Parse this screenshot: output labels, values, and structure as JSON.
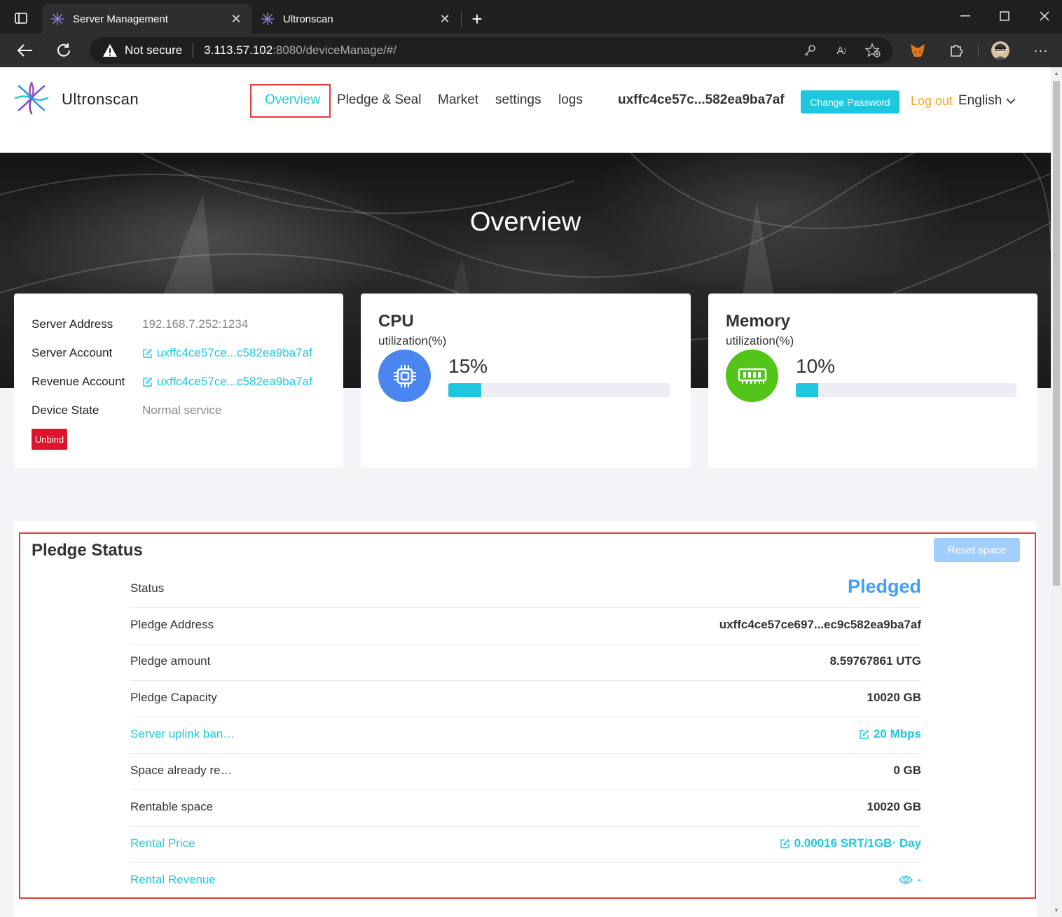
{
  "browser": {
    "tabs": [
      {
        "title": "Server Management",
        "active": true
      },
      {
        "title": "Ultronscan",
        "active": false
      }
    ],
    "address": {
      "security": "Not secure",
      "host": "3.113.57.102",
      "rest": ":8080/deviceManage/#/"
    }
  },
  "header": {
    "brand": "Ultronscan",
    "menu": [
      {
        "label": "Overview",
        "active": true
      },
      {
        "label": "Pledge & Seal"
      },
      {
        "label": "Market"
      },
      {
        "label": "settings"
      },
      {
        "label": "logs"
      }
    ],
    "account": "uxffc4ce57c...582ea9ba7af",
    "change_password": "Change Password",
    "logout": "Log out",
    "language": "English"
  },
  "hero": {
    "title": "Overview"
  },
  "server_card": {
    "rows": [
      {
        "label": "Server Address",
        "value": "192.168.7.252:1234"
      },
      {
        "label": "Server Account",
        "value": "uxffc4ce57ce...c582ea9ba7af"
      },
      {
        "label": "Revenue Account",
        "value": "uxffc4ce57ce...c582ea9ba7af"
      },
      {
        "label": "Device State",
        "value": "Normal service"
      }
    ],
    "unbind": "Unbind"
  },
  "cpu": {
    "title": "CPU",
    "subtitle": "utilization(%)",
    "percent_text": "15%",
    "percent": 15
  },
  "memory": {
    "title": "Memory",
    "subtitle": "utilization(%)",
    "percent_text": "10%",
    "percent": 10
  },
  "pledge": {
    "title": "Pledge Status",
    "reset": "Reset space",
    "rows": [
      {
        "label": "Status",
        "value": "Pledged"
      },
      {
        "label": "Pledge Address",
        "value": "uxffc4ce57ce697...ec9c582ea9ba7af"
      },
      {
        "label": "Pledge amount",
        "value": "8.59767861 UTG"
      },
      {
        "label": "Pledge Capacity",
        "value": "10020 GB"
      },
      {
        "label": "Server uplink ban…",
        "value": "20 Mbps"
      },
      {
        "label": "Space already re…",
        "value": "0 GB"
      },
      {
        "label": "Rentable space",
        "value": "10020 GB"
      },
      {
        "label": "Rental Price",
        "value": "0.00016 SRT/1GB· Day"
      },
      {
        "label": "Rental Revenue",
        "value": "-"
      }
    ]
  },
  "colors": {
    "accent": "#1ec7de",
    "warning": "#f5a623",
    "danger": "#e0132c",
    "primary": "#409eff",
    "cpu_icon": "#4a86f0",
    "memory_icon": "#52c41a",
    "highlight": "#e5383b"
  }
}
